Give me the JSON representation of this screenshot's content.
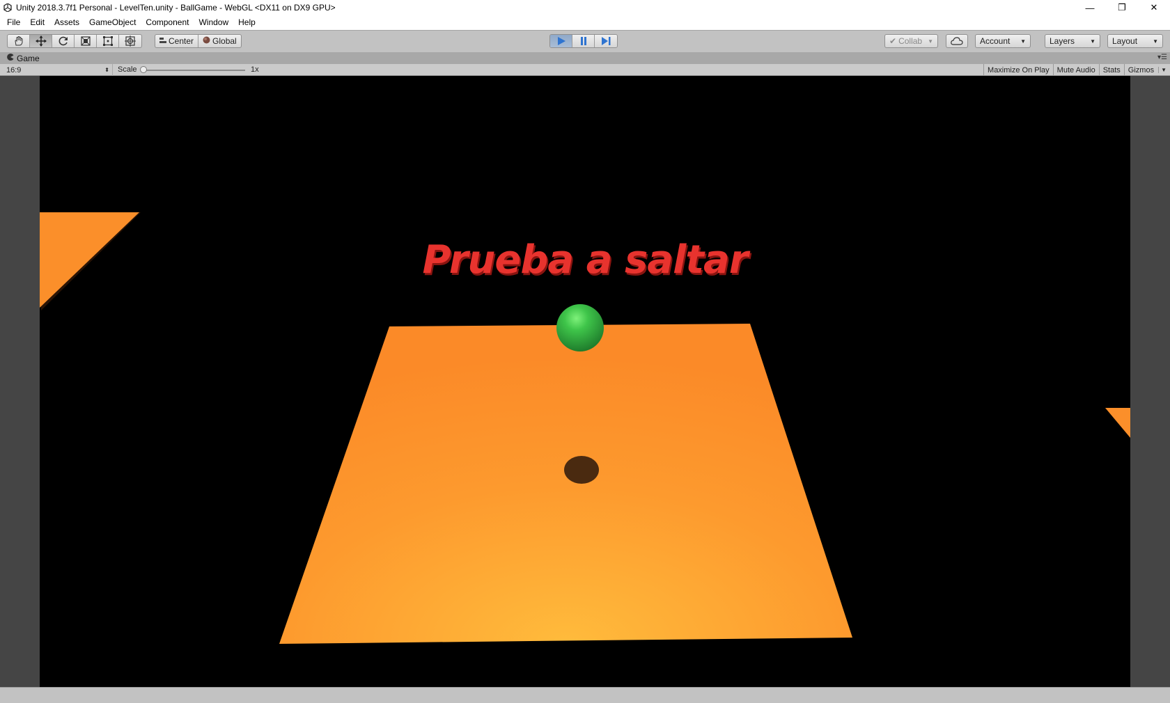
{
  "window": {
    "title": "Unity 2018.3.7f1 Personal - LevelTen.unity - BallGame - WebGL <DX11 on DX9 GPU>",
    "controls": {
      "minimize": "—",
      "restore": "❐",
      "close": "✕"
    }
  },
  "menu": [
    "File",
    "Edit",
    "Assets",
    "GameObject",
    "Component",
    "Window",
    "Help"
  ],
  "toolbar": {
    "tools": [
      "hand-tool",
      "move-tool",
      "rotate-tool",
      "scale-tool",
      "rect-tool",
      "transform-tool"
    ],
    "active_tool": "move-tool",
    "pivot_label": "Center",
    "space_label": "Global",
    "play_state": "playing",
    "collab_label": "Collab",
    "account_label": "Account",
    "layers_label": "Layers",
    "layout_label": "Layout"
  },
  "game_tab": {
    "label": "Game",
    "aspect": "16:9",
    "scale_label": "Scale",
    "scale_value": "1x",
    "maximize_label": "Maximize On Play",
    "mute_label": "Mute Audio",
    "stats_label": "Stats",
    "gizmos_label": "Gizmos"
  },
  "game": {
    "hint_text": "Prueba a saltar",
    "colors": {
      "platform": "#fb8f2a",
      "platform_glow": "#ffb53a",
      "ball": "#2fae3f",
      "hint": "#e8332e",
      "background": "#000000"
    }
  }
}
